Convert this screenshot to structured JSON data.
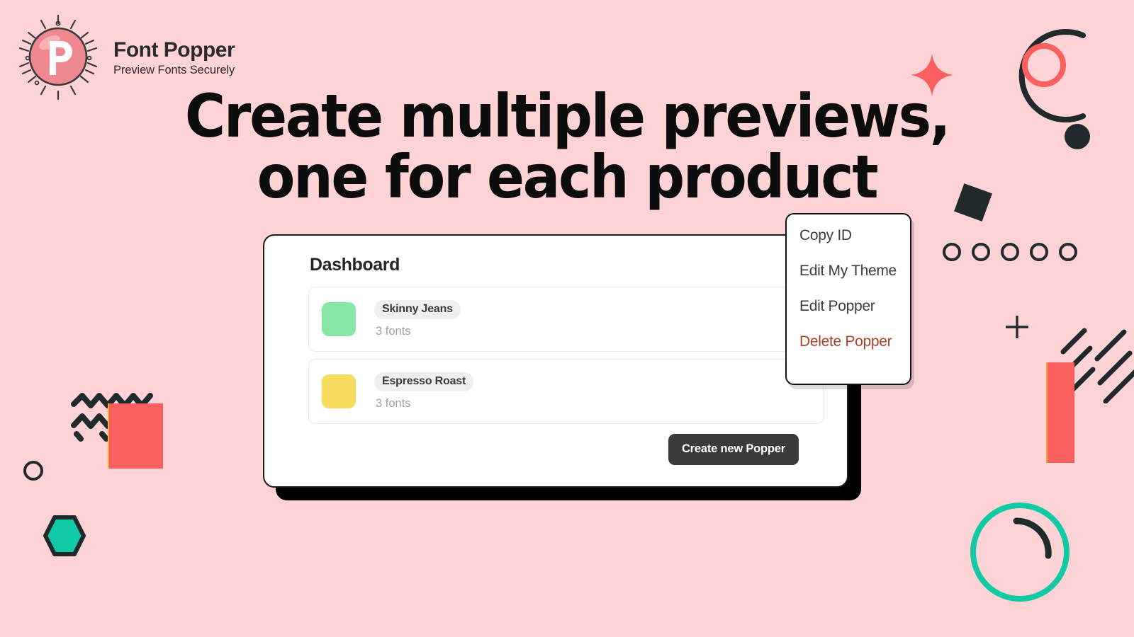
{
  "brand": {
    "name": "Font Popper",
    "tagline": "Preview Fonts Securely",
    "logo_letter": "P",
    "logo_icon": "bubble-p-logo",
    "logo_color": "#F08892"
  },
  "headline": {
    "line1": "Create multiple previews,",
    "line2": "one for each product"
  },
  "dashboard": {
    "title": "Dashboard",
    "create_button_label": "Create new Popper",
    "poppers": [
      {
        "name": "Skinny Jeans",
        "fonts": "3 fonts",
        "swatch_color": "#86E8A4"
      },
      {
        "name": "Espresso Roast",
        "fonts": "3 fonts",
        "swatch_color": "#F7DD5E"
      }
    ]
  },
  "context_menu": {
    "items": [
      {
        "label": "Copy ID",
        "danger": false
      },
      {
        "label": "Edit My Theme",
        "danger": false
      },
      {
        "label": "Edit Popper",
        "danger": false
      },
      {
        "label": "Delete Popper",
        "danger": true
      }
    ]
  },
  "colors": {
    "background": "#FDD3D6",
    "coral": "#F9605F",
    "teal": "#12C9A5",
    "dark": "#20292C",
    "danger_text": "#A8402C",
    "button_dark": "#3A3A3A"
  },
  "decorations": [
    "sparkle-shape",
    "arc-circle",
    "coral-ring",
    "dark-dot",
    "dark-diamond",
    "dot-row",
    "plus-mark",
    "coral-bar",
    "hatch-lines",
    "teal-ring",
    "zigzag-lines",
    "coral-square",
    "dark-ring",
    "teal-hexagon"
  ]
}
